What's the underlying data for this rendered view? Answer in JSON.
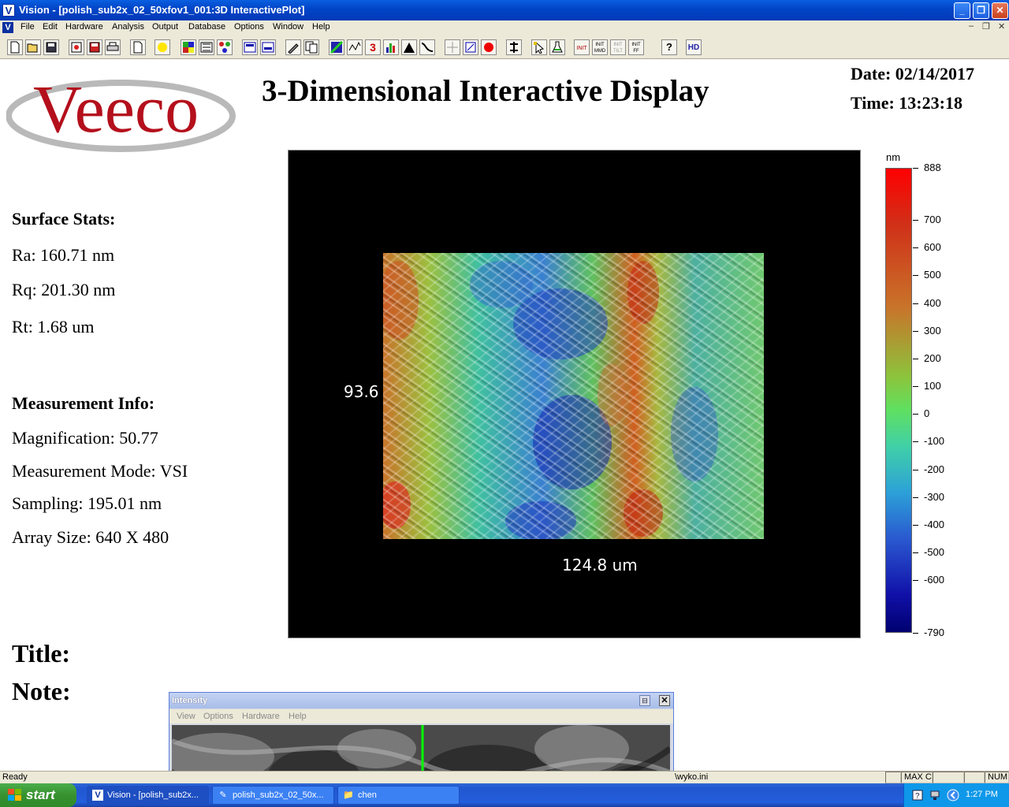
{
  "window": {
    "app_icon": "V",
    "title": "Vision - [polish_sub2x_02_50xfov1_001:3D InteractivePlot]",
    "minimize_glyph": "_",
    "restore_glyph": "❐",
    "close_glyph": "✕"
  },
  "menu": {
    "icon": "V",
    "items": [
      "File",
      "Edit",
      "Hardware",
      "Analysis",
      "Output",
      "Database",
      "Options",
      "Window",
      "Help"
    ],
    "mdi_min": "–",
    "mdi_restore": "❐",
    "mdi_close": "✕"
  },
  "toolbar": {
    "buttons": [
      "new-icon",
      "open-icon",
      "save-icon",
      "print-preview-icon",
      "save-as-icon",
      "print-icon",
      "page-icon",
      "light-icon",
      "color-map-icon",
      "mask-icon",
      "color-dots-icon",
      "report-icon",
      "report2-icon",
      "pencil-icon",
      "copy-icon",
      "contour-icon",
      "profile-icon",
      "3d-icon",
      "histogram-icon",
      "peak-icon",
      "curve-icon",
      "grid-icon",
      "ruler-icon",
      "record-icon",
      "align-icon",
      "pointer-icon",
      "flask-icon",
      "init-icon",
      "init-mmd-icon",
      "init-tilt-icon",
      "init-ff-icon",
      "help-icon",
      "hd-icon"
    ],
    "labels": {
      "init1": "INIT",
      "init2": "INIT MMD",
      "init3": "INIT TILT",
      "init4": "INIT FF",
      "help": "?",
      "hd": "HD",
      "three_d": "3"
    }
  },
  "logo": {
    "text": "Veeco"
  },
  "heading": "3-Dimensional Interactive Display",
  "date": "Date: 02/14/2017",
  "time": "Time: 13:23:18",
  "surface_stats": {
    "heading": "Surface Stats:",
    "ra": "Ra: 160.71 nm",
    "rq": "Rq: 201.30 nm",
    "rt": "Rt: 1.68 um"
  },
  "measurement_info": {
    "heading": "Measurement Info:",
    "magnification": "Magnification: 50.77",
    "mode": "Measurement Mode: VSI",
    "sampling": "Sampling: 195.01 nm",
    "array_size": "Array Size: 640 X 480"
  },
  "title_label": "Title:",
  "note_label": "Note:",
  "plot": {
    "y_extent_label": "93.6",
    "x_extent_label": "124.8 um",
    "colorbar_unit": "nm",
    "colorbar_labels": [
      {
        "label": "888",
        "value": 888
      },
      {
        "label": "700",
        "value": 700
      },
      {
        "label": "600",
        "value": 600
      },
      {
        "label": "500",
        "value": 500
      },
      {
        "label": "400",
        "value": 400
      },
      {
        "label": "300",
        "value": 300
      },
      {
        "label": "200",
        "value": 200
      },
      {
        "label": "100",
        "value": 100
      },
      {
        "label": "0",
        "value": 0
      },
      {
        "label": "-100",
        "value": -100
      },
      {
        "label": "-200",
        "value": -200
      },
      {
        "label": "-300",
        "value": -300
      },
      {
        "label": "-400",
        "value": -400
      },
      {
        "label": "-500",
        "value": -500
      },
      {
        "label": "-600",
        "value": -600
      },
      {
        "label": "-790",
        "value": -790
      }
    ],
    "colorbar_range": [
      -790,
      888
    ],
    "colors": {
      "high": "#ff0000",
      "mid": "#60e060",
      "low": "#000070"
    }
  },
  "intensity_window": {
    "title": "Intensity",
    "menu": [
      "View",
      "Options",
      "Hardware",
      "Help"
    ],
    "pin_glyph": "⊟",
    "close_glyph": "✕"
  },
  "status": {
    "left": "Ready",
    "ini": "\\wyko.ini",
    "maxc": "MAX C",
    "num": "NUM"
  },
  "taskbar": {
    "start": "start",
    "tasks": [
      {
        "label": "Vision - [polish_sub2x...",
        "icon": "V"
      },
      {
        "label": "polish_sub2x_02_50x...",
        "icon": "✎"
      },
      {
        "label": "chen",
        "icon": "📁"
      }
    ],
    "clock": "1:27 PM"
  }
}
